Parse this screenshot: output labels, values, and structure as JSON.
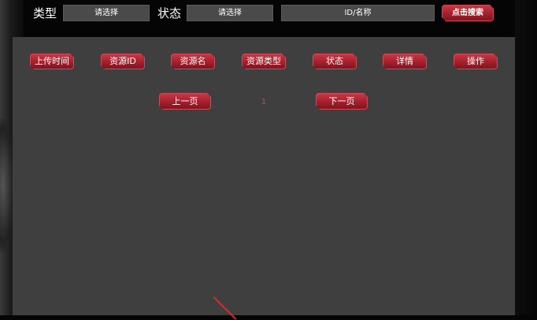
{
  "filters": {
    "type_label": "类型",
    "type_select": "请选择",
    "status_label": "状态",
    "status_select": "请选择",
    "search_field": "ID/名称",
    "search_button": "点击搜索"
  },
  "table": {
    "columns": [
      "上传时间",
      "资源ID",
      "资源名",
      "资源类型",
      "状态",
      "详情",
      "操作"
    ]
  },
  "pagination": {
    "prev": "上一页",
    "current_page": "1",
    "next": "下一页"
  },
  "colors": {
    "accent": "#a2202c",
    "panel": "#3f3f3f",
    "page_number": "#d9442e"
  }
}
